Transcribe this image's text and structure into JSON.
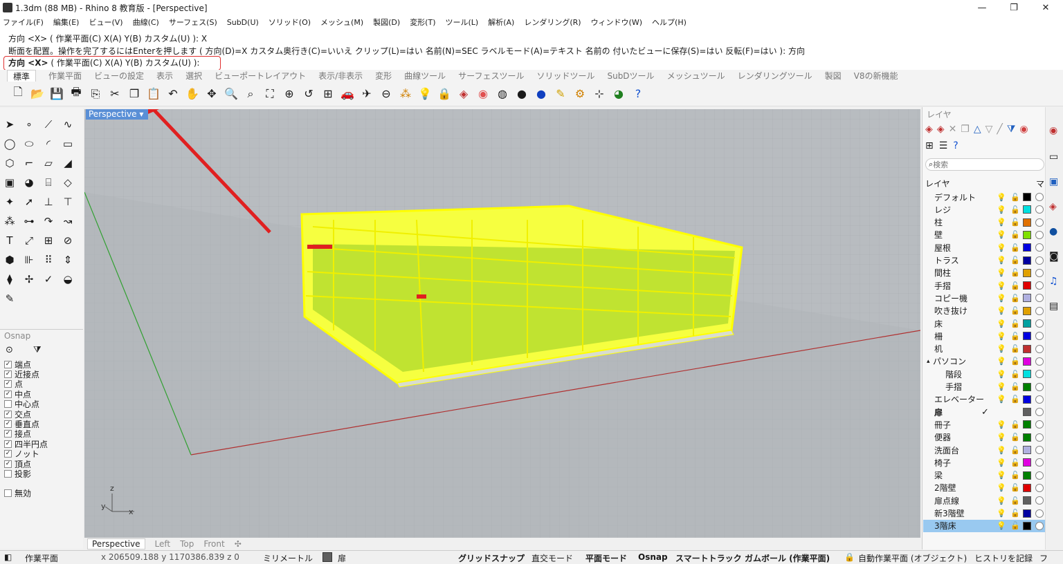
{
  "window": {
    "title": "1.3dm (88 MB) - Rhino 8 教育版 - [Perspective]",
    "minimize": "—",
    "maximize": "❐",
    "close": "✕"
  },
  "menu": [
    "ファイル(F)",
    "編集(E)",
    "ビュー(V)",
    "曲線(C)",
    "サーフェス(S)",
    "SubD(U)",
    "ソリッド(O)",
    "メッシュ(M)",
    "製図(D)",
    "変形(T)",
    "ツール(L)",
    "解析(A)",
    "レンダリング(R)",
    "ウィンドウ(W)",
    "ヘルプ(H)"
  ],
  "command": {
    "history1": "方向 <X> ( 作業平面(C)  X(A)  Y(B)  カスタム(U) ): X",
    "history2": "断面を配置。操作を完了するにはEnterを押します ( 方向(D)=X  カスタム奥行き(C)=いいえ  クリップ(L)=はい  名前(N)=SEC  ラベルモード(A)=テキスト  名前の 付いたビューに保存(S)=はい  反転(F)=はい ): 方向",
    "prompt_bold": "方向 <X>",
    "prompt_rest": " ( 作業平面(C)  X(A)  Y(B)  カスタム(U) ):"
  },
  "tabs": [
    "標準",
    "作業平面",
    "ビューの設定",
    "表示",
    "選択",
    "ビューポートレイアウト",
    "表示/非表示",
    "変形",
    "曲線ツール",
    "サーフェスツール",
    "ソリッドツール",
    "SubDツール",
    "メッシュツール",
    "レンダリングツール",
    "製図",
    "V8の新機能"
  ],
  "toolbar_icons": [
    "new-icon",
    "open-icon",
    "save-icon",
    "print-icon",
    "import-icon",
    "cut-icon",
    "copy-icon",
    "paste-icon",
    "undo-icon",
    "pan-icon",
    "rotate-icon",
    "zoom-icon",
    "zoom-window-icon",
    "zoom-extents-icon",
    "zoom-selected-icon",
    "undo-view-icon",
    "viewport-layout-icon",
    "car-icon",
    "plane-icon",
    "cplane-icon",
    "points-icon",
    "light-icon",
    "lock-icon",
    "layer-icon",
    "color-icon",
    "sphere-wire-icon",
    "sphere-shaded-icon",
    "render-icon",
    "brush-icon",
    "gear-icon",
    "grid-icon",
    "globe-icon",
    "help-icon"
  ],
  "osnap": {
    "title": "Osnap",
    "items": [
      {
        "label": "端点",
        "checked": true
      },
      {
        "label": "近接点",
        "checked": true
      },
      {
        "label": "点",
        "checked": true
      },
      {
        "label": "中点",
        "checked": true
      },
      {
        "label": "中心点",
        "checked": false
      },
      {
        "label": "交点",
        "checked": true
      },
      {
        "label": "垂直点",
        "checked": true
      },
      {
        "label": "接点",
        "checked": true
      },
      {
        "label": "四半円点",
        "checked": true
      },
      {
        "label": "ノット",
        "checked": true
      },
      {
        "label": "頂点",
        "checked": true
      },
      {
        "label": "投影",
        "checked": false
      }
    ],
    "disable": "無効"
  },
  "viewport": {
    "label": "Perspective",
    "axis_y": "y",
    "axis_z": "z",
    "axis_x": "x"
  },
  "viewport_tabs": [
    "Perspective",
    "Left",
    "Top",
    "Front",
    "✣"
  ],
  "layers": {
    "title": "レイヤ",
    "search_placeholder": "検索",
    "header_name": "レイヤ",
    "header_mat": "マ",
    "items": [
      {
        "name": "デフォルト",
        "color": "#000000",
        "indent": false
      },
      {
        "name": "レジ",
        "color": "#00e0e0",
        "indent": false
      },
      {
        "name": "柱",
        "color": "#e07000",
        "indent": false
      },
      {
        "name": "壁",
        "color": "#80e000",
        "indent": false
      },
      {
        "name": "屋根",
        "color": "#0000e0",
        "indent": false
      },
      {
        "name": "トラス",
        "color": "#0000a0",
        "indent": false
      },
      {
        "name": "間柱",
        "color": "#e0a000",
        "indent": false
      },
      {
        "name": "手摺",
        "color": "#e00000",
        "indent": false
      },
      {
        "name": "コピー機",
        "color": "#b0b0e0",
        "indent": false
      },
      {
        "name": "吹き抜け",
        "color": "#e0a000",
        "indent": false
      },
      {
        "name": "床",
        "color": "#00a0a0",
        "indent": false
      },
      {
        "name": "柵",
        "color": "#0000e0",
        "indent": false
      },
      {
        "name": "机",
        "color": "#c03030",
        "indent": false
      },
      {
        "name": "パソコン",
        "color": "#e000e0",
        "indent": false,
        "expand": "▴"
      },
      {
        "name": "階段",
        "color": "#00e0e0",
        "indent": true
      },
      {
        "name": "手摺",
        "color": "#008000",
        "indent": true
      },
      {
        "name": "エレベーター",
        "color": "#0000e0",
        "indent": false
      },
      {
        "name": "扉",
        "color": "#606060",
        "indent": false,
        "current": true
      },
      {
        "name": "冊子",
        "color": "#008000",
        "indent": false
      },
      {
        "name": "便器",
        "color": "#008000",
        "indent": false
      },
      {
        "name": "洗面台",
        "color": "#b0b0e0",
        "indent": false
      },
      {
        "name": "椅子",
        "color": "#e000e0",
        "indent": false
      },
      {
        "name": "梁",
        "color": "#008000",
        "indent": false
      },
      {
        "name": "2階壁",
        "color": "#e00000",
        "indent": false
      },
      {
        "name": "扉点線",
        "color": "#606060",
        "indent": false
      },
      {
        "name": "新3階壁",
        "color": "#0000a0",
        "indent": false
      },
      {
        "name": "3階床",
        "color": "#000000",
        "indent": false,
        "selected": true
      }
    ]
  },
  "status": {
    "cplane": "作業平面",
    "coords": "x 206509.188  y 1170386.839  z 0",
    "units": "ミリメートル",
    "layer": "扉",
    "gridsnap": "グリッドスナップ",
    "ortho": "直交モード",
    "planar": "平面モード",
    "osnap": "Osnap",
    "smarttrack": "スマートトラック",
    "gumball": "ガムボール (作業平面)",
    "autocplane": "自動作業平面 (オブジェクト)",
    "history": "ヒストリを記録",
    "filter": "フ"
  },
  "colors": {
    "accent": "#5a8fd6",
    "model": "#ffff00",
    "highlight": "#e03030"
  }
}
